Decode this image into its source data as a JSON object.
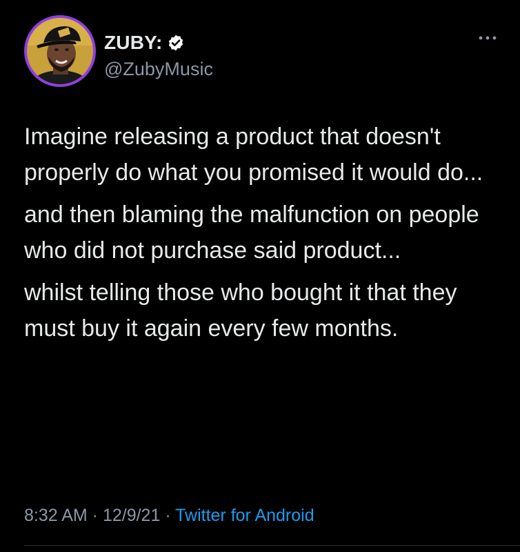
{
  "author": {
    "display_name": "ZUBY:",
    "handle": "@ZubyMusic",
    "verified": true,
    "avatar_icon": "profile-avatar",
    "avatar_ring_color": "#8f3fe0"
  },
  "menu": {
    "icon": "more-options-icon"
  },
  "tweet": {
    "paragraphs": [
      "Imagine releasing a product that doesn't properly do what you promised it would do...",
      "and then blaming the malfunction on people who did not purchase said product...",
      "whilst telling those who bought it that they must buy it again every few months."
    ]
  },
  "meta": {
    "time": "8:32 AM",
    "separator": " · ",
    "date": "12/9/21",
    "source": "Twitter for Android"
  },
  "colors": {
    "background": "#000000",
    "text": "#e7e9ea",
    "muted": "#8b98a5",
    "link": "#1d9bf0"
  }
}
